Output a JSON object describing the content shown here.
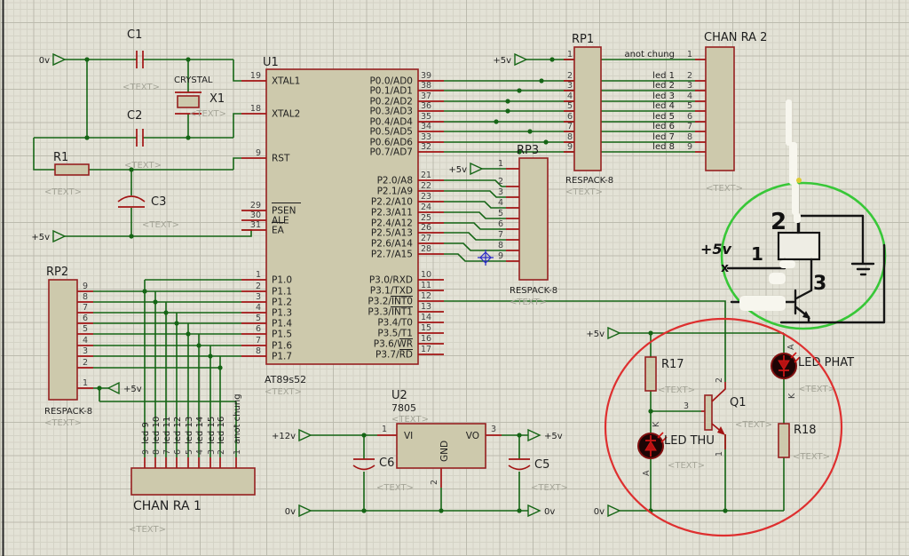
{
  "placeholder": "<TEXT>",
  "power": {
    "v0": "0v",
    "v5": "+5v",
    "v12": "+12v"
  },
  "left": {
    "c1": "C1",
    "c2": "C2",
    "c3": "C3",
    "r1": "R1",
    "crystal": "CRYSTAL",
    "x1": "X1"
  },
  "u1": {
    "ref": "U1",
    "part": "AT89s52",
    "left_pins": [
      {
        "n": "19",
        "l": "XTAL1"
      },
      {
        "n": "18",
        "l": "XTAL2"
      },
      {
        "n": "9",
        "l": "RST"
      },
      {
        "n": "29",
        "l": "PSEN"
      },
      {
        "n": "30",
        "l": "ALE"
      },
      {
        "n": "31",
        "l": "EA"
      },
      {
        "n": "1",
        "l": "P1.0"
      },
      {
        "n": "2",
        "l": "P1.1"
      },
      {
        "n": "3",
        "l": "P1.2"
      },
      {
        "n": "4",
        "l": "P1.3"
      },
      {
        "n": "5",
        "l": "P1.4"
      },
      {
        "n": "6",
        "l": "P1.5"
      },
      {
        "n": "7",
        "l": "P1.6"
      },
      {
        "n": "8",
        "l": "P1.7"
      }
    ],
    "right_pins": [
      {
        "n": "39",
        "l": "P0.0/AD0"
      },
      {
        "n": "38",
        "l": "P0.1/AD1"
      },
      {
        "n": "37",
        "l": "P0.2/AD2"
      },
      {
        "n": "36",
        "l": "P0.3/AD3"
      },
      {
        "n": "35",
        "l": "P0.4/AD4"
      },
      {
        "n": "34",
        "l": "P0.5/AD5"
      },
      {
        "n": "33",
        "l": "P0.6/AD6"
      },
      {
        "n": "32",
        "l": "P0.7/AD7"
      },
      {
        "n": "21",
        "l": "P2.0/A8"
      },
      {
        "n": "22",
        "l": "P2.1/A9"
      },
      {
        "n": "23",
        "l": "P2.2/A10"
      },
      {
        "n": "24",
        "l": "P2.3/A11"
      },
      {
        "n": "25",
        "l": "P2.4/A12"
      },
      {
        "n": "26",
        "l": "P2.5/A13"
      },
      {
        "n": "27",
        "l": "P2.6/A14"
      },
      {
        "n": "28",
        "l": "P2.7/A15"
      },
      {
        "n": "10",
        "l": "P3.0/RXD"
      },
      {
        "n": "11",
        "l": "P3.1/TXD"
      },
      {
        "n": "12",
        "l": "P3.2/INT0"
      },
      {
        "n": "13",
        "l": "P3.3/INT1"
      },
      {
        "n": "14",
        "l": "P3.4/T0"
      },
      {
        "n": "15",
        "l": "P3.5/T1"
      },
      {
        "n": "16",
        "l": "P3.6/WR"
      },
      {
        "n": "17",
        "l": "P3.7/RD"
      }
    ]
  },
  "rp1": {
    "ref": "RP1",
    "part": "RESPACK-8",
    "pins": [
      "1",
      "2",
      "3",
      "4",
      "5",
      "6",
      "7",
      "8",
      "9"
    ]
  },
  "rp2": {
    "ref": "RP2",
    "part": "RESPACK-8",
    "pins": [
      "9",
      "8",
      "7",
      "6",
      "5",
      "4",
      "3",
      "2",
      "1"
    ]
  },
  "rp3": {
    "ref": "RP3",
    "part": "RESPACK-8",
    "pins": [
      "1",
      "2",
      "3",
      "4",
      "5",
      "6",
      "7",
      "8",
      "9"
    ]
  },
  "chanra2": {
    "ref": "CHAN RA 2",
    "pin_nums": [
      "1",
      "2",
      "3",
      "4",
      "5",
      "6",
      "7",
      "8",
      "9"
    ],
    "nets": [
      "anot chung",
      "led 1",
      "led 2",
      "led 3",
      "led 4",
      "led 5",
      "led 6",
      "led 7",
      "led 8"
    ]
  },
  "chanra1": {
    "ref": "CHAN RA 1",
    "pin_nums": [
      "9",
      "8",
      "7",
      "6",
      "5",
      "4",
      "3",
      "2",
      "1"
    ],
    "nets": [
      "led 9",
      "led 10",
      "led 11",
      "led 12",
      "led 13",
      "led 14",
      "led 15",
      "led 16",
      "anot chung"
    ]
  },
  "u2": {
    "ref": "U2",
    "part": "7805",
    "vi": "VI",
    "vo": "VO",
    "gnd": "GND",
    "p1": "1",
    "p2": "2",
    "p3": "3"
  },
  "caps": {
    "c5": "C5",
    "c6": "C6"
  },
  "driver": {
    "r17": "R17",
    "r18": "R18",
    "q1": "Q1",
    "led_thu": "LED THU",
    "led_phat": "LED PHAT",
    "k": "K",
    "a": "A",
    "p1": "1",
    "p2": "2",
    "p3": "3"
  },
  "hand": {
    "n1": "1",
    "n2": "2",
    "n3": "3",
    "v5": "+5v",
    "x": "x"
  }
}
